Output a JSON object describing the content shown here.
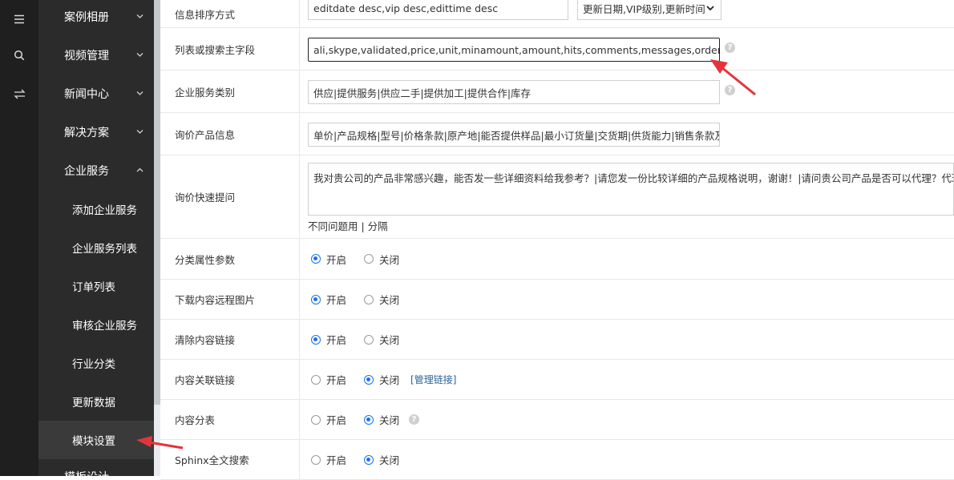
{
  "rail": {
    "icons": [
      "menu-icon",
      "search-icon",
      "switch-arrows-icon"
    ]
  },
  "sidebar": {
    "groups": [
      {
        "label": "案例相册",
        "expanded": false
      },
      {
        "label": "视频管理",
        "expanded": false
      },
      {
        "label": "新闻中心",
        "expanded": false
      },
      {
        "label": "解决方案",
        "expanded": false
      },
      {
        "label": "企业服务",
        "expanded": true
      }
    ],
    "subitems": [
      {
        "label": "添加企业服务"
      },
      {
        "label": "企业服务列表"
      },
      {
        "label": "订单列表"
      },
      {
        "label": "审核企业服务"
      },
      {
        "label": "行业分类"
      },
      {
        "label": "更新数据"
      },
      {
        "label": "模块设置",
        "active": true
      }
    ],
    "cutoff_label": "模板设计"
  },
  "form": {
    "sort": {
      "label": "信息排序方式",
      "value": "editdate desc,vip desc,edittime desc",
      "select_value": "更新日期,VIP级别,更新时间"
    },
    "list_fields": {
      "label": "列表或搜索主字段",
      "value": "ali,skype,validated,price,unit,minamount,amount,hits,comments,messages,orders,baojia"
    },
    "service_types": {
      "label": "企业服务类别",
      "value": "供应|提供服务|供应二手|提供加工|提供合作|库存"
    },
    "inquiry_info": {
      "label": "询价产品信息",
      "value": "单价|产品规格|型号|价格条款|原产地|能否提供样品|最小订货量|交货期|供货能力|销售条款及附"
    },
    "quick_questions": {
      "label": "询价快速提问",
      "value": "我对贵公司的产品非常感兴趣，能否发一些详细资料给我参考？|请您发一份比较详细的产品规格说明，谢谢！|请问贵公司产品是否可以代理？代理条件",
      "hint": "不同问题用 | 分隔"
    },
    "radios": [
      {
        "label": "分类属性参数",
        "on_label": "开启",
        "off_label": "关闭",
        "value": "on"
      },
      {
        "label": "下载内容远程图片",
        "on_label": "开启",
        "off_label": "关闭",
        "value": "on"
      },
      {
        "label": "清除内容链接",
        "on_label": "开启",
        "off_label": "关闭",
        "value": "on"
      },
      {
        "label": "内容关联链接",
        "on_label": "开启",
        "off_label": "关闭",
        "value": "off",
        "link": "[管理链接]"
      },
      {
        "label": "内容分表",
        "on_label": "开启",
        "off_label": "关闭",
        "value": "off",
        "help": true
      },
      {
        "label": "Sphinx全文搜索",
        "on_label": "开启",
        "off_label": "关闭",
        "value": "off"
      }
    ]
  },
  "colors": {
    "accent": "#1a73e8",
    "annotation": "#e5333c",
    "sidebar_bg": "#2b2b2b"
  }
}
